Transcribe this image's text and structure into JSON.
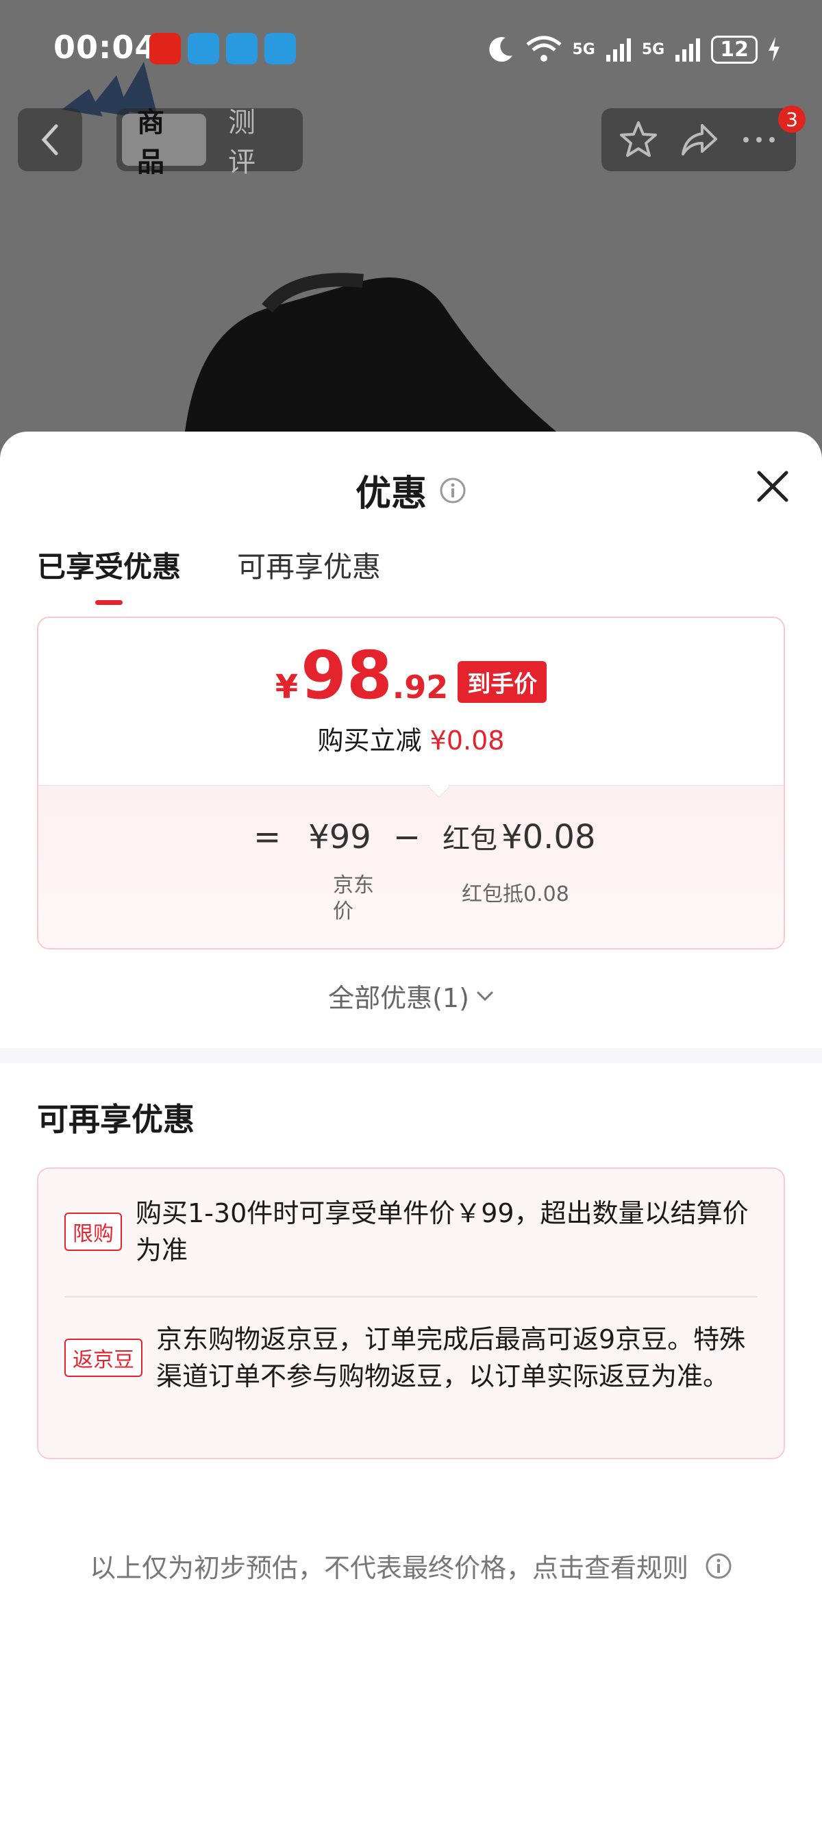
{
  "status_bar": {
    "time": "00:04",
    "network_1": "5G",
    "network_2": "5G",
    "battery": "12"
  },
  "nav": {
    "tabs": [
      "商品",
      "测评"
    ],
    "active_tab": "商品",
    "notification_count": "3"
  },
  "sheet": {
    "title": "优惠",
    "tabs": [
      "已享受优惠",
      "可再享优惠"
    ],
    "active_tab": "已享受优惠",
    "price_card": {
      "currency": "¥",
      "price_integer": "98",
      "price_decimal": ".92",
      "price_tag": "到手价",
      "instant_label": "购买立减",
      "instant_amount": "¥0.08",
      "equation": {
        "equals": "=",
        "original_price": "¥99",
        "minus": "−",
        "redpacket_label": "红包",
        "redpacket_amount": "¥0.08",
        "original_caption": "京东价",
        "redpacket_caption": "红包抵0.08"
      }
    },
    "all_discounts": "全部优惠(1)",
    "more_section_title": "可再享优惠",
    "offers": [
      {
        "tag": "限购",
        "text": "购买1-30件时可享受单件价￥99，超出数量以结算价为准"
      },
      {
        "tag": "返京豆",
        "text": "京东购物返京豆，订单完成后最高可返9京豆。特殊渠道订单不参与购物返豆，以订单实际返豆为准。"
      }
    ],
    "footer_note": "以上仅为初步预估，不代表最终价格，点击查看规则"
  },
  "colors": {
    "accent_red": "#e5232d",
    "overlay": "#707070"
  }
}
